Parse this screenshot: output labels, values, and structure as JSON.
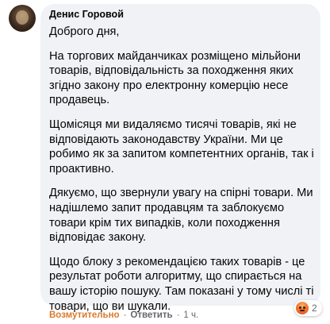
{
  "comment": {
    "author": "Денис Горовой",
    "paragraphs": [
      "Доброго дня,",
      "На торгових майданчиках розміщено мільйони товарів, відповідальність за походження яких згідно закону про електронну комерцію несе продавець.",
      "Щомісяця ми видаляємо тисячі товарів, які не відповідають законодавству України. Ми це робимо як за запитом компетентних органів, так і проактивно.",
      "Дякуємо, що звернули увагу на спірні товари. Ми надішлемо запит продавцям та заблокуємо товари крім тих випадків, коли походження відповідає закону.",
      "Щодо блоку з рекомендацією таких товарів - це результат роботи алгоритму, що спирається на вашу історію пошуку. Там показані у тому числі ті товари, що ви шукали."
    ]
  },
  "actions": {
    "reaction_label": "Возмутительно",
    "reply_label": "Ответить",
    "separator": "·",
    "time": "1 ч."
  },
  "reactions": {
    "icon": "angry-icon",
    "count": "2",
    "reaction_color": "#d97a2b"
  }
}
